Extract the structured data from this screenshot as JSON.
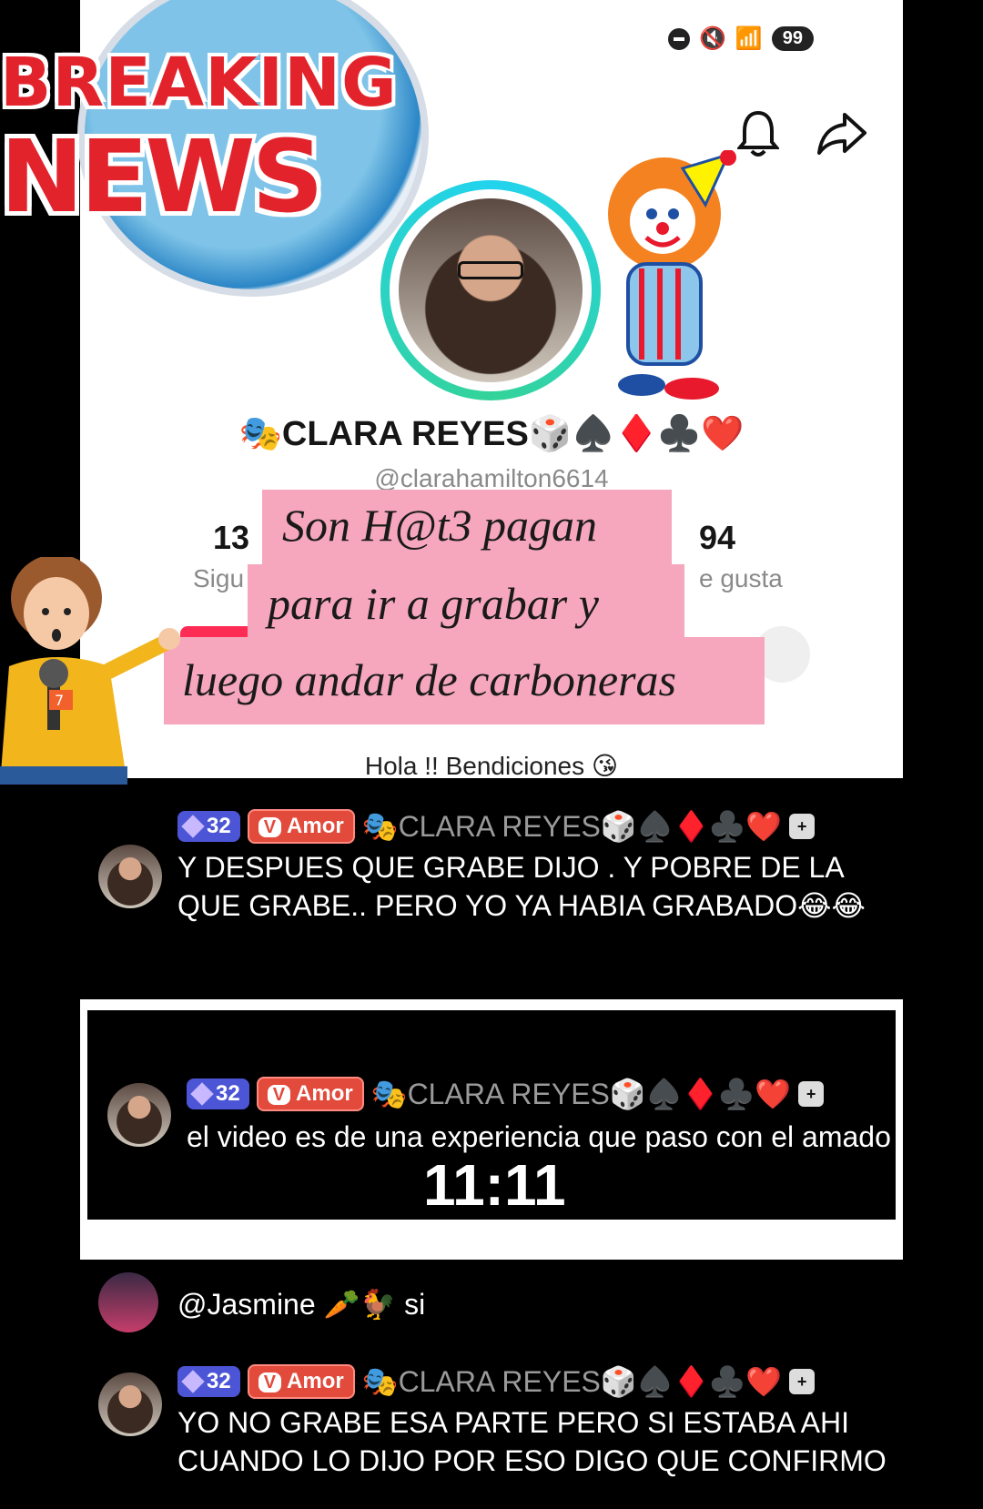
{
  "status_bar": {
    "battery": "99"
  },
  "profile": {
    "name": "🎭CLARA REYES🎲♠️♦️♣️❤️",
    "handle": "@clarahamilton6614",
    "following": {
      "value": "13",
      "label": "Sigu"
    },
    "likes": {
      "value": "94",
      "label": "e gusta"
    },
    "bio": "Hola !! Bendiciones 😘"
  },
  "overlay": {
    "breaking": "BREAKING",
    "news": "NEWS",
    "caption_lines": [
      "Son H@t3  pagan",
      "para ir a grabar  y",
      "luego andar de carboneras"
    ]
  },
  "comments": [
    {
      "level": "32",
      "fan_badge": "Amor",
      "name": "🎭CLARA REYES🎲♠️♦️♣️❤️",
      "text": "Y DESPUES QUE GRABE DIJO .  Y POBRE DE LA QUE GRABE.. PERO YO YA HABIA GRABADO😂😂"
    },
    {
      "level": "32",
      "fan_badge": "Amor",
      "name": "🎭CLARA REYES🎲♠️♦️♣️❤️",
      "text": "el video es de una experiencia que paso con el amado"
    },
    {
      "text": "@Jasmine 🥕🐓  si"
    },
    {
      "level": "32",
      "fan_badge": "Amor",
      "name": "🎭CLARA REYES🎲♠️♦️♣️❤️",
      "text": "YO NO GRABE ESA PARTE PERO SI ESTABA AHI CUANDO LO DIJO POR ESO DIGO QUE CONFIRMO"
    }
  ],
  "time_overlay": "11:11",
  "icons": [
    "bell-icon",
    "share-icon",
    "clown-sticker",
    "reporter-sticker",
    "globe-icon",
    "gem-icon",
    "user-add-icon"
  ]
}
